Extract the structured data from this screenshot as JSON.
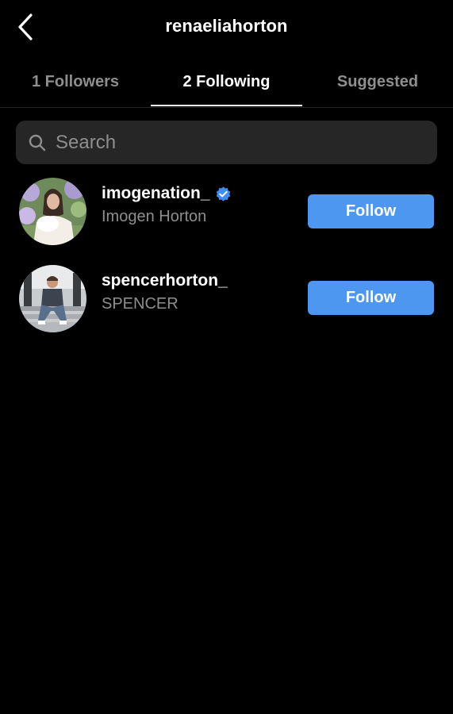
{
  "header": {
    "title": "renaeliahorton",
    "back_icon": "chevron-left-icon"
  },
  "tabs": [
    {
      "label": "1 Followers",
      "active": false
    },
    {
      "label": "2 Following",
      "active": true
    },
    {
      "label": "Suggested",
      "active": false
    }
  ],
  "search": {
    "placeholder": "Search",
    "value": "",
    "icon": "search-icon"
  },
  "users": [
    {
      "handle": "imogenation_",
      "full_name": "Imogen Horton",
      "verified": true,
      "follow_label": "Follow",
      "avatar_icon": "avatar-photo"
    },
    {
      "handle": "spencerhorton_",
      "full_name": "SPENCER",
      "verified": false,
      "follow_label": "Follow",
      "avatar_icon": "avatar-photo"
    }
  ],
  "colors": {
    "background": "#000000",
    "follow_button": "#4d97f0",
    "verified_badge": "#3d8ef0",
    "secondary_text": "#8e8e8e",
    "search_bg": "#262626"
  }
}
